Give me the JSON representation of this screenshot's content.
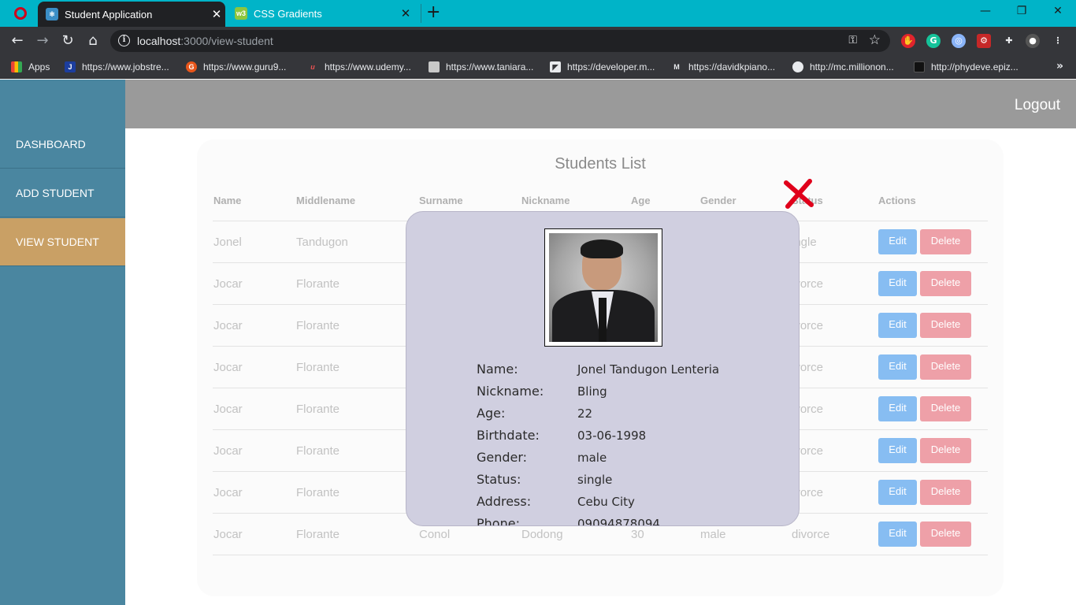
{
  "browser": {
    "tabs": [
      {
        "title": "Student Application",
        "icon": "react-icon"
      },
      {
        "title": "CSS Gradients",
        "icon": "w3-icon"
      }
    ],
    "url_host": "localhost",
    "url_path": ":3000/view-student",
    "bookmarks": [
      {
        "label": "Apps",
        "icon": "apps-grid-icon",
        "color": "#e8eaed"
      },
      {
        "label": "https://www.jobstre...",
        "icon": "jobstreet-icon",
        "color": "#1c3e9e",
        "glyph": "J"
      },
      {
        "label": "https://www.guru9...",
        "icon": "guru99-icon",
        "color": "#e8561b",
        "glyph": "G"
      },
      {
        "label": "https://www.udemy...",
        "icon": "udemy-icon",
        "color": "#35363a",
        "glyph": "u"
      },
      {
        "label": "https://www.taniara...",
        "icon": "floppy-icon",
        "color": "#9aa0a6",
        "glyph": ""
      },
      {
        "label": "https://developer.m...",
        "icon": "mdn-icon",
        "color": "#e8eaed",
        "glyph": ""
      },
      {
        "label": "https://davidkpiano...",
        "icon": "davidkpiano-icon",
        "color": "#35363a",
        "glyph": "M"
      },
      {
        "label": "http://mc.millionon...",
        "icon": "globe-icon",
        "color": "#e8eaed",
        "glyph": ""
      },
      {
        "label": "http://phydeve.epiz...",
        "icon": "phydeve-icon",
        "color": "#111111",
        "glyph": ""
      }
    ]
  },
  "sidebar": {
    "items": [
      {
        "label": "DASHBOARD",
        "active": false
      },
      {
        "label": "ADD STUDENT",
        "active": false
      },
      {
        "label": "VIEW STUDENT",
        "active": true
      }
    ]
  },
  "topbar": {
    "logout_label": "Logout"
  },
  "table": {
    "title": "Students List",
    "columns": [
      "Name",
      "Middlename",
      "Surname",
      "Nickname",
      "Age",
      "Gender",
      "Status",
      "Actions"
    ],
    "edit_label": "Edit",
    "delete_label": "Delete",
    "rows": [
      {
        "name": "Jonel",
        "middlename": "Tandugon",
        "surname": "",
        "nickname": "",
        "age": "",
        "gender": "",
        "status": "ingle"
      },
      {
        "name": "Jocar",
        "middlename": "Florante",
        "surname": "",
        "nickname": "",
        "age": "",
        "gender": "",
        "status": "ivorce"
      },
      {
        "name": "Jocar",
        "middlename": "Florante",
        "surname": "",
        "nickname": "",
        "age": "",
        "gender": "",
        "status": "ivorce"
      },
      {
        "name": "Jocar",
        "middlename": "Florante",
        "surname": "",
        "nickname": "",
        "age": "",
        "gender": "",
        "status": "ivorce"
      },
      {
        "name": "Jocar",
        "middlename": "Florante",
        "surname": "",
        "nickname": "",
        "age": "",
        "gender": "",
        "status": "ivorce"
      },
      {
        "name": "Jocar",
        "middlename": "Florante",
        "surname": "",
        "nickname": "",
        "age": "",
        "gender": "",
        "status": "ivorce"
      },
      {
        "name": "Jocar",
        "middlename": "Florante",
        "surname": "",
        "nickname": "",
        "age": "",
        "gender": "",
        "status": "ivorce"
      },
      {
        "name": "Jocar",
        "middlename": "Florante",
        "surname": "Conol",
        "nickname": "Dodong",
        "age": "30",
        "gender": "male",
        "status": "divorce"
      }
    ]
  },
  "modal": {
    "fields": [
      {
        "label": "Name:",
        "value": "Jonel Tandugon Lenteria"
      },
      {
        "label": "Nickname:",
        "value": "Bling"
      },
      {
        "label": "Age:",
        "value": "22"
      },
      {
        "label": "Birthdate:",
        "value": "03-06-1998"
      },
      {
        "label": "Gender:",
        "value": "male"
      },
      {
        "label": "Status:",
        "value": "single"
      },
      {
        "label": "Address:",
        "value": "Cebu City"
      },
      {
        "label": "Phone:",
        "value": "09094878094"
      }
    ],
    "close_color": "#e0001b"
  }
}
